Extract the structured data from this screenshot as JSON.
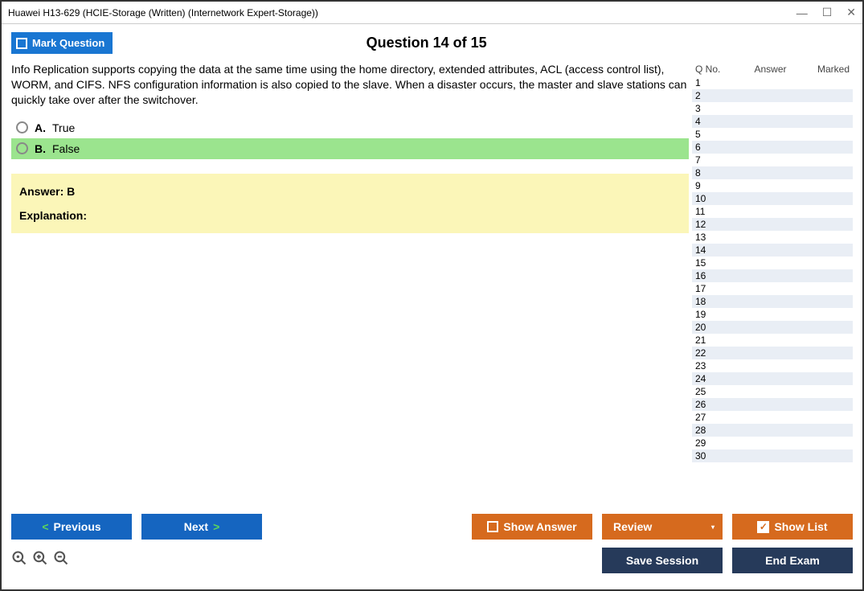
{
  "window_title": "Huawei H13-629 (HCIE-Storage (Written) (Internetwork Expert-Storage))",
  "mark_question_label": "Mark Question",
  "question_header": "Question 14 of 15",
  "question_text": "Info Replication supports copying the data at the same time using the home directory, extended attributes, ACL (access control list), WORM, and CIFS. NFS configuration information is also copied to the slave. When a disaster occurs, the master and slave stations can quickly take over after the switchover.",
  "options": [
    {
      "letter": "A.",
      "text": "True",
      "highlight": false
    },
    {
      "letter": "B.",
      "text": "False",
      "highlight": true
    }
  ],
  "answer_line": "Answer: B",
  "explanation_label": "Explanation:",
  "side_headers": {
    "qno": "Q No.",
    "answer": "Answer",
    "marked": "Marked"
  },
  "question_rows": [
    1,
    2,
    3,
    4,
    5,
    6,
    7,
    8,
    9,
    10,
    11,
    12,
    13,
    14,
    15,
    16,
    17,
    18,
    19,
    20,
    21,
    22,
    23,
    24,
    25,
    26,
    27,
    28,
    29,
    30
  ],
  "buttons": {
    "previous": "Previous",
    "next": "Next",
    "show_answer": "Show Answer",
    "review": "Review",
    "show_list": "Show List",
    "save_session": "Save Session",
    "end_exam": "End Exam"
  }
}
